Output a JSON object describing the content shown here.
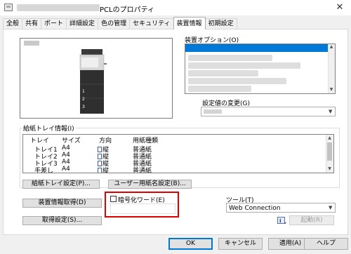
{
  "window": {
    "title_suffix": "PCLのプロパティ",
    "close": "✕",
    "icon": "printer-app-icon"
  },
  "tabs": [
    "全般",
    "共有",
    "ポート",
    "詳細設定",
    "色の管理",
    "セキュリティ",
    "装置情報",
    "初期設定"
  ],
  "active_tab": "装置情報",
  "device_options": {
    "label": "装置オプション(O)",
    "change_label": "設定値の変更(G)",
    "change_value": ""
  },
  "tray_info": {
    "label": "給紙トレイ情報(I)",
    "columns": [
      "トレイ",
      "サイズ",
      "方向",
      "用紙種類"
    ],
    "rows": [
      {
        "tray": "トレイ1",
        "size": "A4",
        "orientation": "縦",
        "paper": "普通紙"
      },
      {
        "tray": "トレイ2",
        "size": "A4",
        "orientation": "縦",
        "paper": "普通紙"
      },
      {
        "tray": "トレイ3",
        "size": "A4",
        "orientation": "縦",
        "paper": "普通紙"
      },
      {
        "tray": "手差し",
        "size": "A4",
        "orientation": "縦",
        "paper": "普通紙"
      }
    ]
  },
  "buttons": {
    "tray_settings": "給紙トレイ設定(P)...",
    "user_paper_name": "ユーザー用紙名設定(B)...",
    "get_device_info": "装置情報取得(D)",
    "acquire_settings": "取得設定(S)...",
    "launch": "起動(R)",
    "ok": "OK",
    "cancel": "キャンセル",
    "apply": "適用(A)",
    "help": "ヘルプ"
  },
  "encryption": {
    "label": "暗号化ワード(E)",
    "checked": false,
    "value": ""
  },
  "tool": {
    "label": "ツール(T)",
    "value": "Web Connection"
  },
  "printer_labels": [
    "1",
    "2",
    "3"
  ],
  "colors": {
    "highlight": "#0078d7",
    "annotation": "#e00000"
  }
}
